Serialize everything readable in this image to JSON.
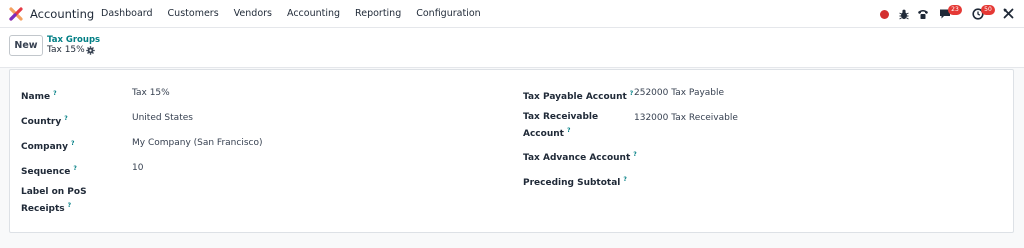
{
  "navbar": {
    "app_name": "Accounting",
    "menu": [
      "Dashboard",
      "Customers",
      "Vendors",
      "Accounting",
      "Reporting",
      "Configuration"
    ],
    "chat_badge": "23",
    "activity_badge": "50"
  },
  "control_panel": {
    "new_label": "New",
    "breadcrumb": "Tax Groups",
    "record_name": "Tax 15%"
  },
  "form": {
    "left": [
      {
        "label": "Name",
        "value": "Tax 15%"
      },
      {
        "label": "Country",
        "value": "United States"
      },
      {
        "label": "Company",
        "value": "My Company (San Francisco)"
      },
      {
        "label": "Sequence",
        "value": "10"
      },
      {
        "label": "Label on PoS Receipts",
        "value": ""
      }
    ],
    "right": [
      {
        "label": "Tax Payable Account",
        "value": "252000 Tax Payable"
      },
      {
        "label": "Tax Receivable Account",
        "value": "132000 Tax Receivable"
      },
      {
        "label": "Tax Advance Account",
        "value": ""
      },
      {
        "label": "Preceding Subtotal",
        "value": ""
      }
    ],
    "help_marker": "?"
  },
  "colors": {
    "accent": "#017e84",
    "badge": "#e53935",
    "record_dot": "#d32f2f"
  }
}
